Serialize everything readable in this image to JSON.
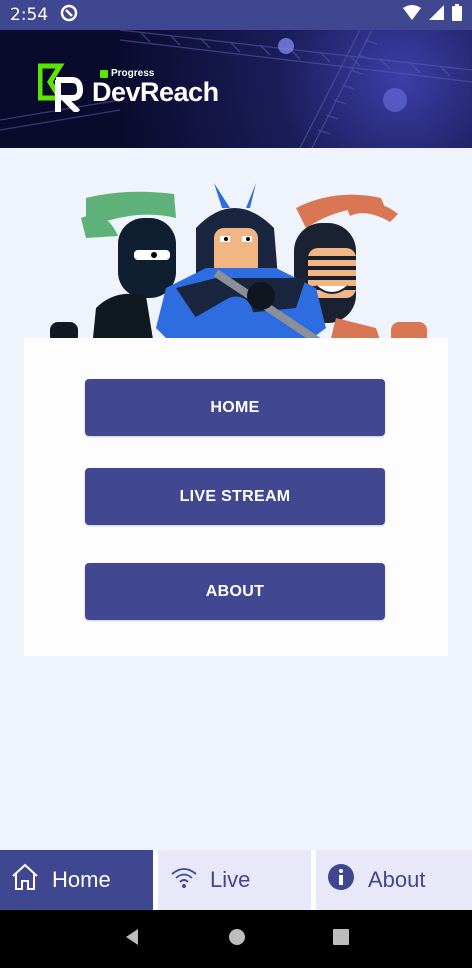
{
  "status_bar": {
    "time": "2:54"
  },
  "header": {
    "logo_small": "Progress",
    "logo_big": "DevReach"
  },
  "menu": {
    "home_label": "HOME",
    "live_label": "LIVE STREAM",
    "about_label": "ABOUT"
  },
  "tabs": [
    {
      "label": "Home",
      "icon": "home-icon",
      "selected": true
    },
    {
      "label": "Live",
      "icon": "wifi-icon",
      "selected": false
    },
    {
      "label": "About",
      "icon": "info-icon",
      "selected": false
    }
  ],
  "colors": {
    "primary": "#414891",
    "tab_inactive_bg": "#e9e8f9",
    "logo_green": "#5ce500"
  }
}
